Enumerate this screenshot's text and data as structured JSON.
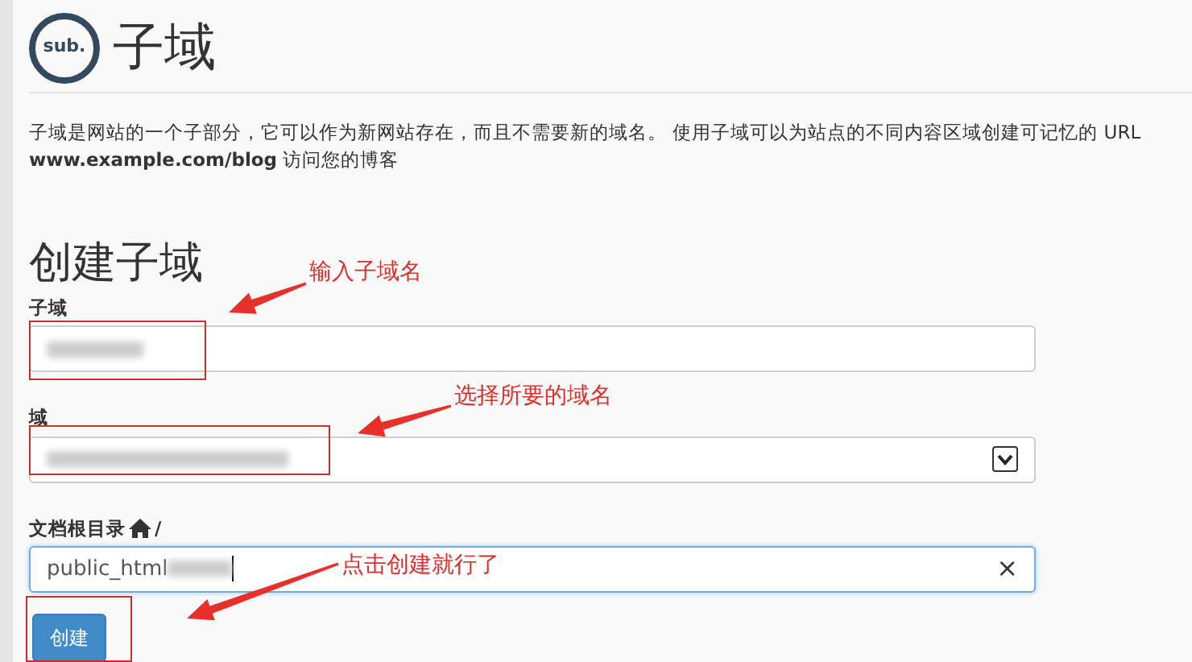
{
  "header": {
    "icon_text": "sub.",
    "title": "子域"
  },
  "description": [
    "子域是网站的一个子部分，它可以作为新网站存在，而且不需要新的域名。 使用子域可以为站点的不同内容区域创建可记忆的 URL",
    "**www.example.com/blog** 访问您的博客"
  ],
  "form": {
    "title": "创建子域",
    "fields": [
      {
        "kind": "text",
        "label": "子域",
        "blurred": true,
        "focused": false
      },
      {
        "kind": "select",
        "label": "域",
        "blurred": true,
        "focused": false
      },
      {
        "kind": "path",
        "label": "文档根目录",
        "label_suffix": "/",
        "value": "public_html",
        "blurred": true,
        "focused": true,
        "clear": "×"
      }
    ],
    "submit": "创建"
  },
  "annotations": [
    {
      "text": "输入子域名"
    },
    {
      "text": "选择所要的域名"
    },
    {
      "text": "点击创建就行了"
    }
  ]
}
